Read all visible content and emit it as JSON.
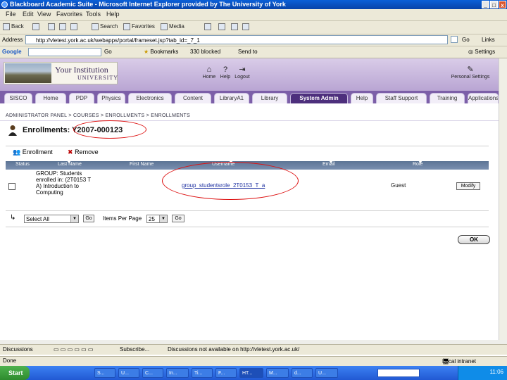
{
  "window": {
    "title": "Blackboard Academic Suite - Microsoft Internet Explorer provided by The University of York",
    "min": "_",
    "max": "□",
    "close": "x"
  },
  "menu": [
    "File",
    "Edit",
    "View",
    "Favorites",
    "Tools",
    "Help"
  ],
  "toolbar": {
    "back": "Back",
    "search": "Search",
    "favorites": "Favorites",
    "media": "Media"
  },
  "address": {
    "label": "Address",
    "url": "http://vletest.york.ac.uk/webapps/portal/frameset.jsp?tab_id=_7_1",
    "go": "Go",
    "links": "Links"
  },
  "google": {
    "logo": "Google",
    "go": "Go",
    "bookmarks": "Bookmarks",
    "blocked": "330 blocked",
    "sendto": "Send to",
    "settings": "Settings"
  },
  "banner": {
    "institution": "Your Institution",
    "university": "UNIVERSITY",
    "home": "Home",
    "help": "Help",
    "logout": "Logout",
    "personal": "Personal Settings"
  },
  "tabs": [
    "SISCO",
    "Home",
    "PDP",
    "Physics",
    "Electronics",
    "Content",
    "LibraryA1",
    "Library",
    "System Admin",
    "Help",
    "Staff Support",
    "Training",
    "Applications"
  ],
  "breadcrumb": "ADMINISTRATOR PANEL > COURSES > ENROLLMENTS > ENROLLMENTS",
  "page": {
    "title_prefix": "Enrollments: ",
    "course_id": "Y2007-000123"
  },
  "actions": {
    "enroll": "Enrollment",
    "remove": "Remove"
  },
  "table": {
    "headers": [
      "Status",
      "Last Name",
      "First Name",
      "Username",
      "Email",
      "Role"
    ],
    "row": {
      "course_lines": [
        "GROUP: Students",
        "enrolled in: (2T0153 T",
        "A) Introduction to",
        "Computing"
      ],
      "username": "group_studentsrole_2T0153_T_a",
      "role": "Guest",
      "modify": "Modify"
    }
  },
  "bottom": {
    "select_all": "Select All",
    "go": "Go",
    "items_per_page_label": "Items Per Page",
    "items_per_page": "25",
    "go2": "Go",
    "ok": "OK"
  },
  "discussion": {
    "label": "Discussions",
    "subscribe": "Subscribe...",
    "msg": "Discussions not available on http://vletest.york.ac.uk/"
  },
  "status": {
    "left": "Done",
    "zone": "Local intranet"
  },
  "taskbar": {
    "start": "Start",
    "items": [
      "S...",
      "U...",
      "C...",
      "In...",
      "Ti...",
      "F...",
      "HT...",
      "M...",
      "d...",
      "U..."
    ],
    "clock": "11:06"
  },
  "colors": {
    "banner": "#c9b8e0",
    "tab_active": "#4d2f7c",
    "annotation": "#d11111"
  }
}
